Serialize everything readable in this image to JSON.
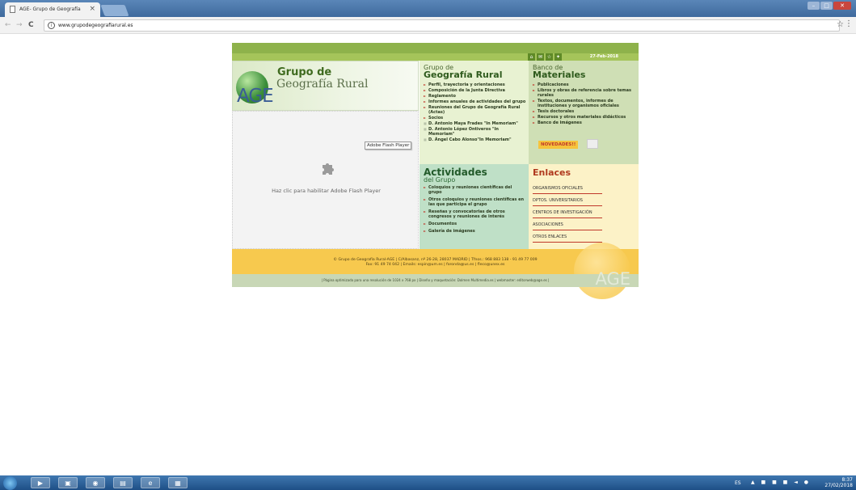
{
  "browser": {
    "tab_title": "AGE- Grupo de Geografía",
    "tab_close": "×",
    "url": "www.grupodegeografiarural.es",
    "back": "←",
    "forward": "→",
    "reload": "C",
    "star": "☆",
    "menu": "⋮",
    "info": "i",
    "minimize": "–",
    "maximize": "□",
    "close": "✕"
  },
  "site": {
    "date": "27-Feb-2018",
    "header_icons": [
      "⌂",
      "✉",
      "☆",
      "✦"
    ],
    "logo": {
      "line1": "Grupo de",
      "line2": "Geografía Rural",
      "mark": "AGE"
    },
    "flash_message": "Haz clic para habilitar Adobe Flash Player",
    "flash_tooltip": "Adobe Flash Player",
    "grupo": {
      "small": "Grupo de",
      "big": "Geografía Rural",
      "items": [
        "Perfil, trayectoria y orientaciones",
        "Composición de la Junta Directiva",
        "Reglamento",
        "Informes anuales de actividades del grupo",
        "Reuniones del Grupo de Geografía Rural (Actas)",
        "Socios",
        "D. Antonio Maya Frades \"In Memoriam\"",
        "D. Antonio López Ontiveros \"In Memoriam\"",
        "D. Ángel Cabo Alonso\"In Memoriam\""
      ]
    },
    "banco": {
      "small": "Banco de",
      "big": "Materiales",
      "items": [
        "Publicaciones",
        "Libros y obras de referencia sobre temas rurales",
        "Textos, documentos, informes de instituciones y organismos oficiales",
        "Tesis doctorales",
        "Recursos y otros materiales didácticos",
        "Banco de imágenes"
      ],
      "novedades": "NOVEDADES!!"
    },
    "actividades": {
      "big": "Actividades",
      "small": "del Grupo",
      "items": [
        "Coloquios y reuniones científicas del grupo",
        "Otros coloquios y reuniones científicas en las que participa el grupo",
        "Reseñas y convocatorias de otros congresos y reuniones de interés",
        "Documentos",
        "Galería de imágenes"
      ]
    },
    "enlaces": {
      "title": "Enlaces",
      "items": [
        "ORGANISMOS OFICIALES",
        "DPTOS. UNIVERSITARIOS",
        "CENTROS DE INVESTIGACIÓN",
        "ASOCIACIONES",
        "OTROS ENLACES"
      ]
    },
    "footer_line1": "© Grupo de Geografía Rural-AGE | C/Albasanz, nº 26-28, 28037 MADRID | Tfnos.: 968 883 138 - 91 49 77 009",
    "footer_line2": "Fax: 91 49 74 042 | Emails: espin@um.es | foronda@us.es | fleco@unex.es",
    "footer_bottom": "| Página optimizada para una resolución de 1024 x 768 px | Diseño y maquetación: Dolmen Multimedia.es | webmaster: editorweb@age.es |",
    "footer_mark": "AGE"
  },
  "taskbar": {
    "lang": "ES",
    "tray_icons": "▲ ■ ■ ■ ◄ ●",
    "time": "8:37",
    "date": "27/02/2018",
    "apps": [
      "▶",
      "▣",
      "◉",
      "▤",
      "e",
      "▦"
    ]
  }
}
